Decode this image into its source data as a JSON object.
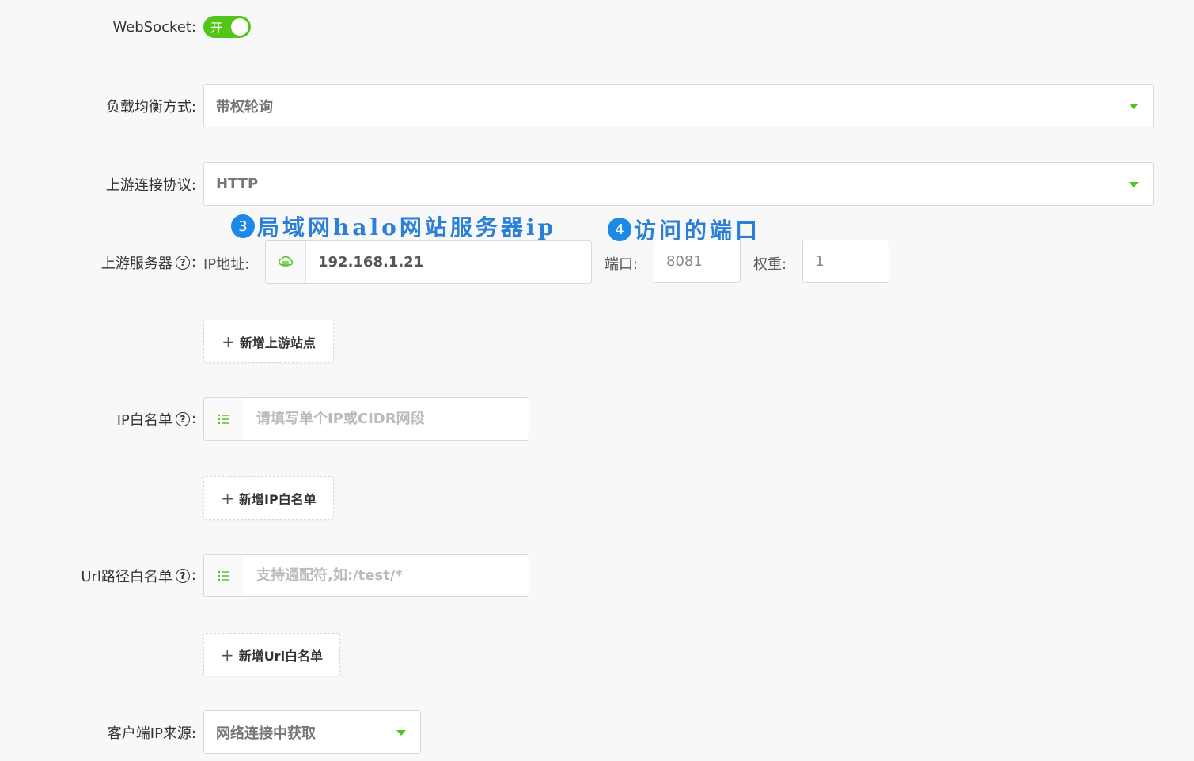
{
  "websocket": {
    "label": "WebSocket:",
    "toggle_text": "开"
  },
  "load_balance": {
    "label": "负载均衡方式:",
    "value": "带权轮询"
  },
  "upstream_protocol": {
    "label": "上游连接协议:",
    "value": "HTTP"
  },
  "annotations": [
    {
      "num": "3",
      "text": "局域网halo网站服务器ip"
    },
    {
      "num": "4",
      "text": "访问的端口"
    }
  ],
  "upstream_server": {
    "label": "上游服务器",
    "help": "?",
    "colon": ":",
    "ip_label": "IP地址:",
    "ip_value": "192.168.1.21",
    "port_label": "端口:",
    "port_value": "8081",
    "weight_label": "权重:",
    "weight_value": "1",
    "add_button": "新增上游站点"
  },
  "ip_whitelist": {
    "label": "IP白名单",
    "help": "?",
    "colon": ":",
    "placeholder": "请填写单个IP或CIDR网段",
    "add_button": "新增IP白名单"
  },
  "url_whitelist": {
    "label": "Url路径白名单",
    "help": "?",
    "colon": ":",
    "placeholder": "支持通配符,如:/test/*",
    "add_button": "新增Url白名单"
  },
  "client_ip_source": {
    "label": "客户端IP来源:",
    "value": "网络连接中获取"
  },
  "plus_symbol": "+",
  "colors": {
    "accent": "#52c41a",
    "annotation": "#2a7fd6"
  }
}
